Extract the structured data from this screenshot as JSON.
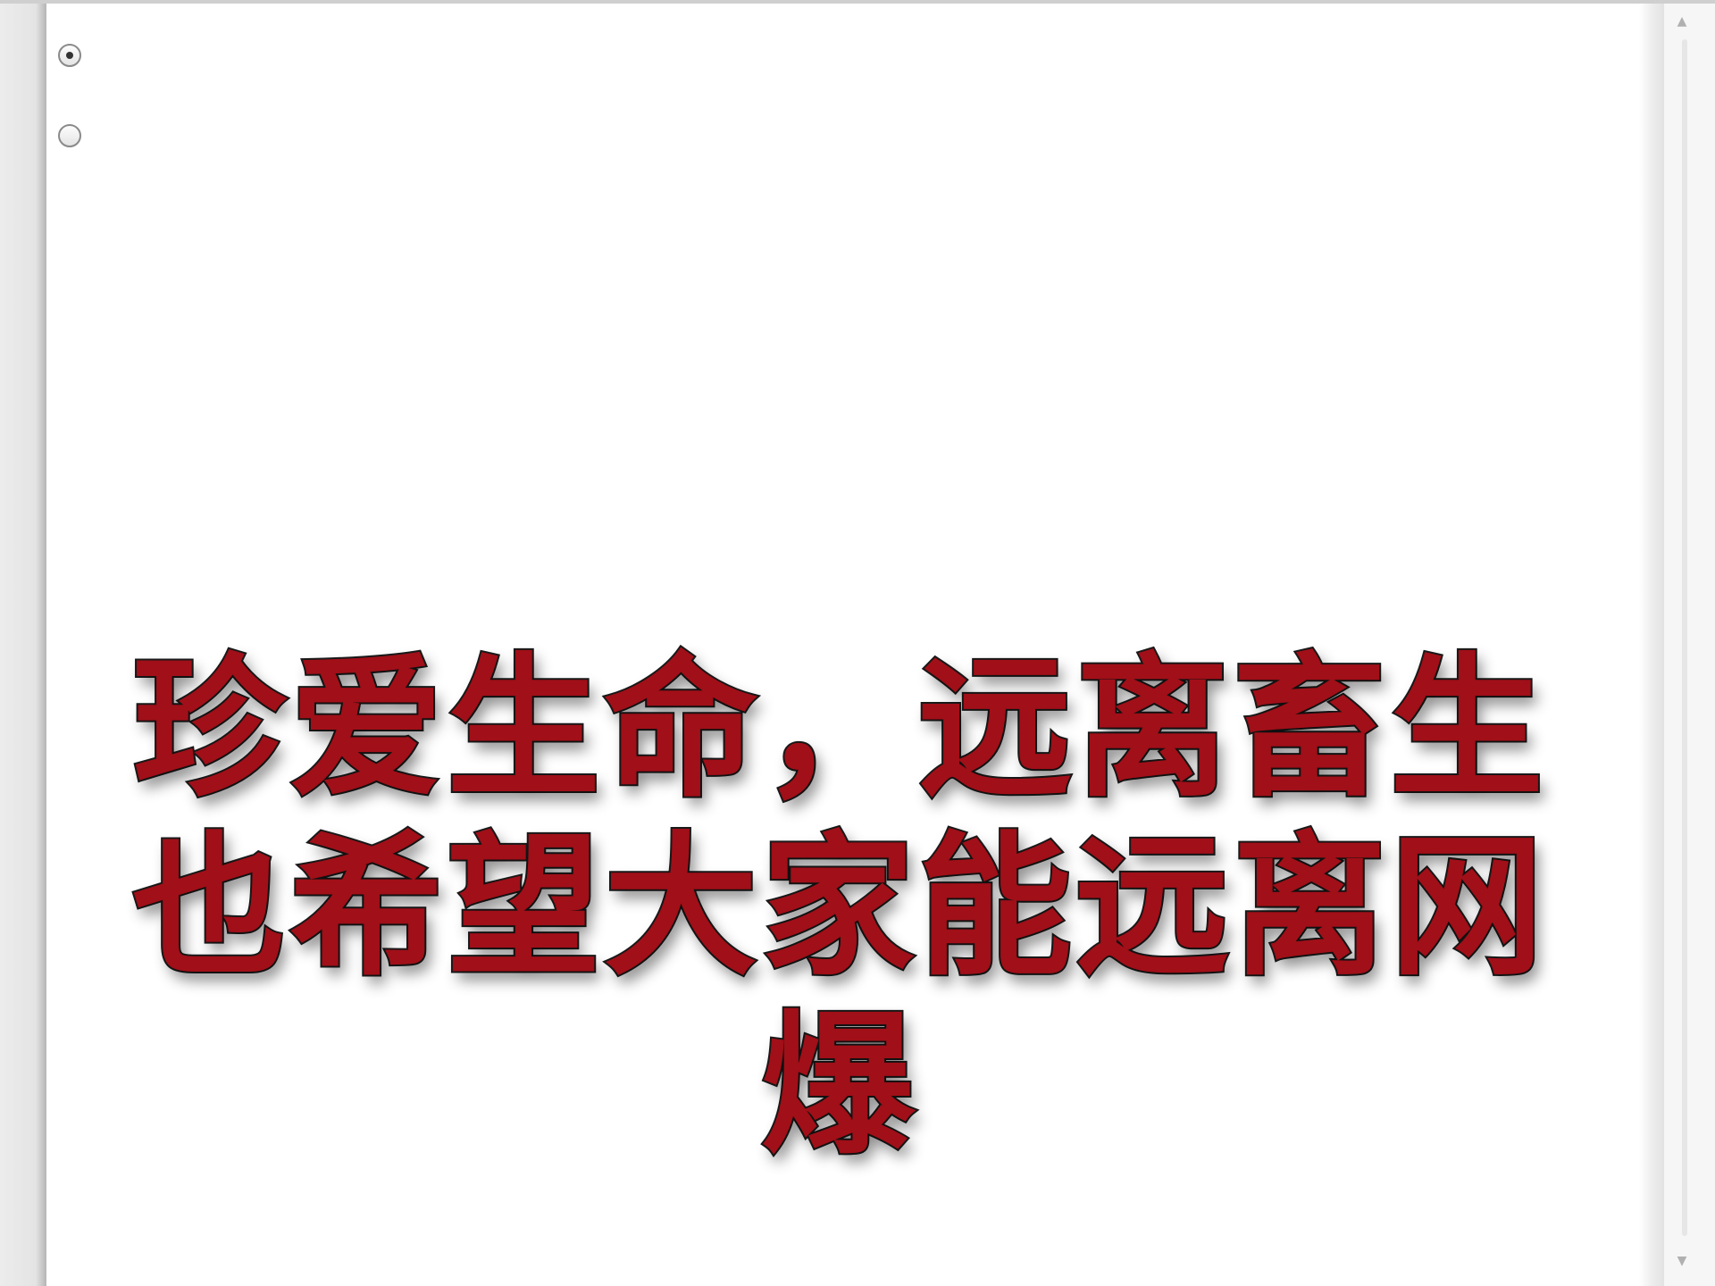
{
  "window": {
    "radio_options": [
      {
        "selected": true
      },
      {
        "selected": false
      }
    ]
  },
  "caption": {
    "line1": "珍爱生命，远离畜生",
    "line2": "也希望大家能远离网",
    "line3": "爆",
    "text_color": "#a10f18",
    "outline_color": "#1a1a1a"
  },
  "icons": {
    "scroll_up": "▲",
    "scroll_down": "▼"
  }
}
